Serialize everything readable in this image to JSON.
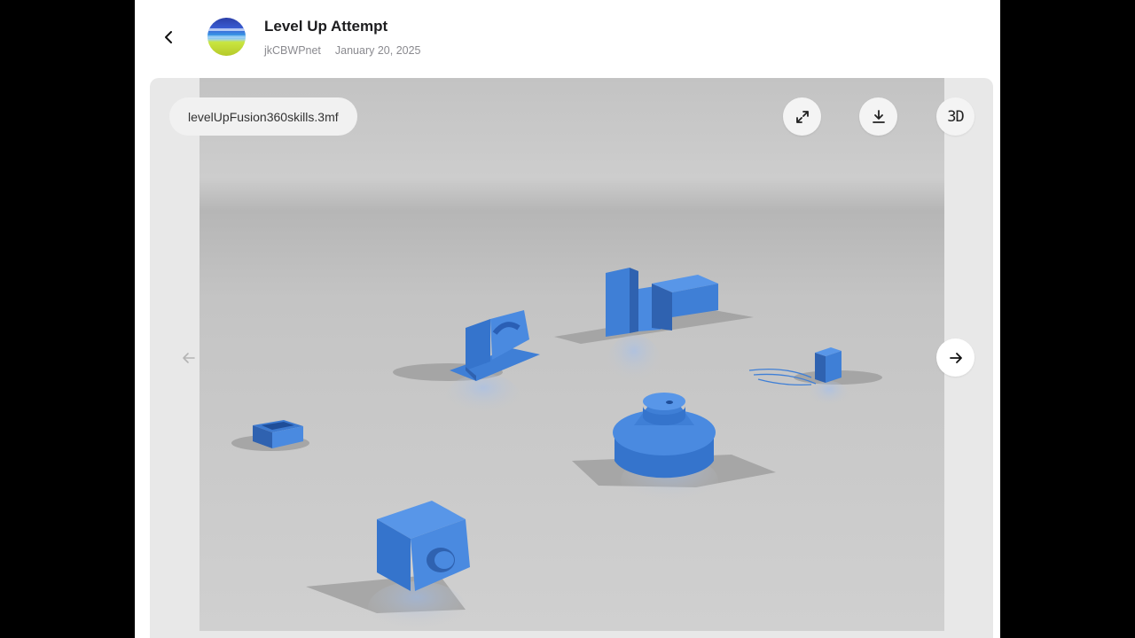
{
  "post": {
    "title": "Level Up Attempt",
    "author": "jkCBWPnet",
    "date": "January 20, 2025"
  },
  "viewer": {
    "filename": "levelUpFusion360skills.3mf",
    "mode_label": "3D"
  },
  "icons": {
    "back": "chevron-left-icon",
    "fullscreen": "expand-icon",
    "download": "download-icon",
    "prev": "arrow-left-icon",
    "next": "arrow-right-icon"
  },
  "colors": {
    "model_blue": "#3f7fd6",
    "floor": "#c8c8c8"
  }
}
